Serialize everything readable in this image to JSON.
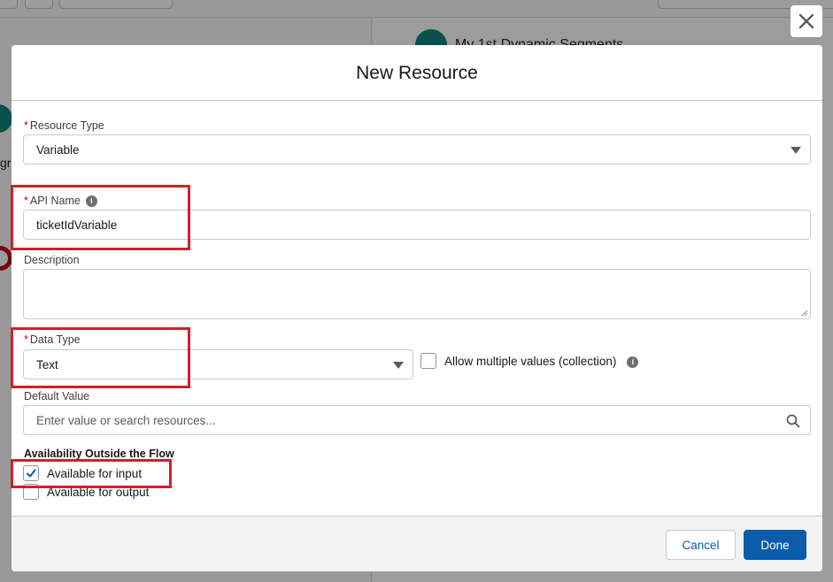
{
  "background": {
    "flow_title": "My 1st Dynamic Segments",
    "left_label": "gr"
  },
  "modal": {
    "title": "New Resource",
    "close_icon": "close-icon",
    "resource_type": {
      "label": "Resource Type",
      "required": "*",
      "value": "Variable"
    },
    "api_name": {
      "label": "API Name",
      "required": "*",
      "value": "ticketIdVariable",
      "info_icon": "info-icon"
    },
    "description": {
      "label": "Description",
      "value": ""
    },
    "data_type": {
      "label": "Data Type",
      "required": "*",
      "value": "Text",
      "allow_multiple_label": "Allow multiple values (collection)",
      "allow_multiple_checked": false
    },
    "default_value": {
      "label": "Default Value",
      "placeholder": "Enter value or search resources...",
      "search_icon": "search-icon"
    },
    "availability": {
      "title": "Availability Outside the Flow",
      "input_label": "Available for input",
      "input_checked": true,
      "output_label": "Available for output",
      "output_checked": false
    },
    "footer": {
      "cancel_label": "Cancel",
      "done_label": "Done"
    }
  },
  "colors": {
    "brand": "#0b5cab",
    "required": "#ba0517",
    "highlight": "#d0202a",
    "node": "#0b827c"
  }
}
